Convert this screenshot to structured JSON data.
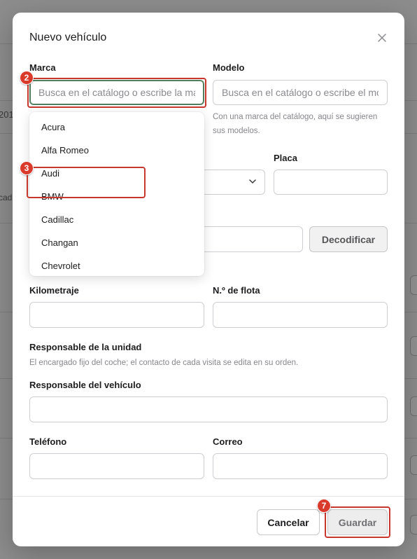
{
  "background": {
    "fragments": [
      "201",
      "cad"
    ]
  },
  "modal": {
    "title": "Nuevo vehículo"
  },
  "brand": {
    "label": "Marca",
    "placeholder": "Busca en el catálogo o escribe la marca"
  },
  "model": {
    "label": "Modelo",
    "placeholder": "Busca en el catálogo o escribe el modelo",
    "helper": "Con una marca del catálogo, aquí se sugieren sus modelos."
  },
  "plate": {
    "label": "Placa"
  },
  "decode_button": "Decodificar",
  "brand_options": [
    "Acura",
    "Alfa Romeo",
    "Audi",
    "BMW",
    "Cadillac",
    "Changan",
    "Chevrolet"
  ],
  "mileage": {
    "label": "Kilometraje"
  },
  "fleet_number": {
    "label": "N.º de flota"
  },
  "responsible_section": {
    "title": "Responsable de la unidad",
    "description": "El encargado fijo del coche; el contacto de cada visita se edita en su orden."
  },
  "vehicle_responsible": {
    "label": "Responsable del vehículo"
  },
  "phone": {
    "label": "Teléfono"
  },
  "email": {
    "label": "Correo"
  },
  "footer": {
    "cancel_label": "Cancelar",
    "save_label": "Guardar"
  },
  "annotations": {
    "badge_brand": "2",
    "badge_options": "3",
    "badge_save": "7",
    "accent_color": "#c8372d"
  }
}
